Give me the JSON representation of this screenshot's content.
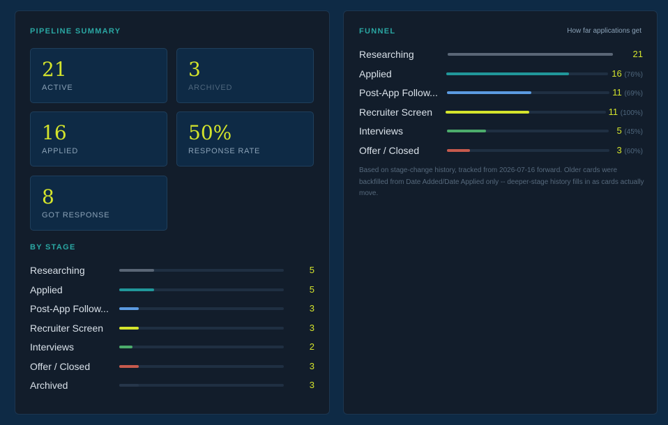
{
  "pipeline_summary": {
    "title": "PIPELINE SUMMARY",
    "stats": [
      {
        "value": "21",
        "label": "ACTIVE"
      },
      {
        "value": "3",
        "label": "ARCHIVED"
      },
      {
        "value": "16",
        "label": "APPLIED"
      },
      {
        "value": "50%",
        "label": "RESPONSE RATE"
      },
      {
        "value": "8",
        "label": "GOT RESPONSE"
      }
    ]
  },
  "by_stage": {
    "title": "BY STAGE",
    "rows": [
      {
        "label": "Researching",
        "count": "5",
        "fraction": 0.21,
        "color": "#5a6676"
      },
      {
        "label": "Applied",
        "count": "5",
        "fraction": 0.21,
        "color": "#20979a"
      },
      {
        "label": "Post-App Follow...",
        "count": "3",
        "fraction": 0.12,
        "color": "#5b9ae0"
      },
      {
        "label": "Recruiter Screen",
        "count": "3",
        "fraction": 0.12,
        "color": "#d4e42c"
      },
      {
        "label": "Interviews",
        "count": "2",
        "fraction": 0.08,
        "color": "#4cac6c"
      },
      {
        "label": "Offer / Closed",
        "count": "3",
        "fraction": 0.12,
        "color": "#c65a4d"
      },
      {
        "label": "Archived",
        "count": "3",
        "fraction": 0.12,
        "color": "#26364a"
      }
    ]
  },
  "funnel": {
    "title": "FUNNEL",
    "subtitle": "How far applications get",
    "rows": [
      {
        "label": "Researching",
        "count": "21",
        "pct": "",
        "fraction": 1.0,
        "color": "#5a6676"
      },
      {
        "label": "Applied",
        "count": "16",
        "pct": "(76%)",
        "fraction": 0.76,
        "color": "#20979a"
      },
      {
        "label": "Post-App Follow...",
        "count": "11",
        "pct": "(69%)",
        "fraction": 0.52,
        "color": "#5b9ae0"
      },
      {
        "label": "Recruiter Screen",
        "count": "11",
        "pct": "(100%)",
        "fraction": 0.52,
        "color": "#d4e42c"
      },
      {
        "label": "Interviews",
        "count": "5",
        "pct": "(45%)",
        "fraction": 0.24,
        "color": "#4cac6c"
      },
      {
        "label": "Offer / Closed",
        "count": "3",
        "pct": "(60%)",
        "fraction": 0.14,
        "color": "#c65a4d"
      }
    ],
    "note": "Based on stage-change history, tracked from 2026-07-16 forward. Older cards were backfilled from Date Added/Date Applied only -- deeper-stage history fills in as cards actually move."
  }
}
